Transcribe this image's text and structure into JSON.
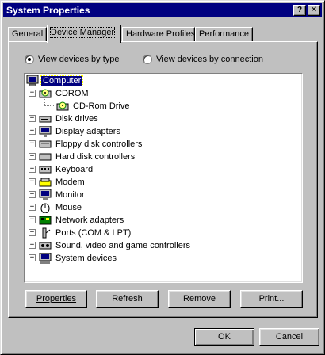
{
  "window": {
    "title": "System Properties",
    "help_glyph": "?",
    "close_glyph": "✕"
  },
  "tabs": [
    {
      "label": "General"
    },
    {
      "label": "Device Manager",
      "active": true
    },
    {
      "label": "Hardware Profiles"
    },
    {
      "label": "Performance"
    }
  ],
  "view_options": {
    "by_type": {
      "label": "View devices by type",
      "checked": true
    },
    "by_connection": {
      "label": "View devices by connection",
      "checked": false
    }
  },
  "tree": {
    "root": {
      "label": "Computer",
      "icon": "computer-icon",
      "selected": true
    },
    "items": [
      {
        "label": "CDROM",
        "icon": "cdrom-icon",
        "expander": "−"
      },
      {
        "label": "CD-Rom Drive",
        "icon": "cdrom-icon",
        "child": true
      },
      {
        "label": "Disk drives",
        "icon": "disk-drive-icon",
        "expander": "+"
      },
      {
        "label": "Display adapters",
        "icon": "display-adapter-icon",
        "expander": "+"
      },
      {
        "label": "Floppy disk controllers",
        "icon": "floppy-controller-icon",
        "expander": "+"
      },
      {
        "label": "Hard disk controllers",
        "icon": "hard-disk-controller-icon",
        "expander": "+"
      },
      {
        "label": "Keyboard",
        "icon": "keyboard-icon",
        "expander": "+"
      },
      {
        "label": "Modem",
        "icon": "modem-icon",
        "expander": "+"
      },
      {
        "label": "Monitor",
        "icon": "monitor-icon",
        "expander": "+"
      },
      {
        "label": "Mouse",
        "icon": "mouse-icon",
        "expander": "+"
      },
      {
        "label": "Network adapters",
        "icon": "network-adapter-icon",
        "expander": "+"
      },
      {
        "label": "Ports (COM & LPT)",
        "icon": "ports-icon",
        "expander": "+"
      },
      {
        "label": "Sound, video and game controllers",
        "icon": "sound-icon",
        "expander": "+"
      },
      {
        "label": "System devices",
        "icon": "system-devices-icon",
        "expander": "+"
      }
    ]
  },
  "buttons": {
    "properties": "Properties",
    "refresh": "Refresh",
    "remove": "Remove",
    "print": "Print...",
    "ok": "OK",
    "cancel": "Cancel"
  },
  "colors": {
    "titlebar": "#000080",
    "face": "#c0c0c0",
    "selection": "#000080"
  }
}
